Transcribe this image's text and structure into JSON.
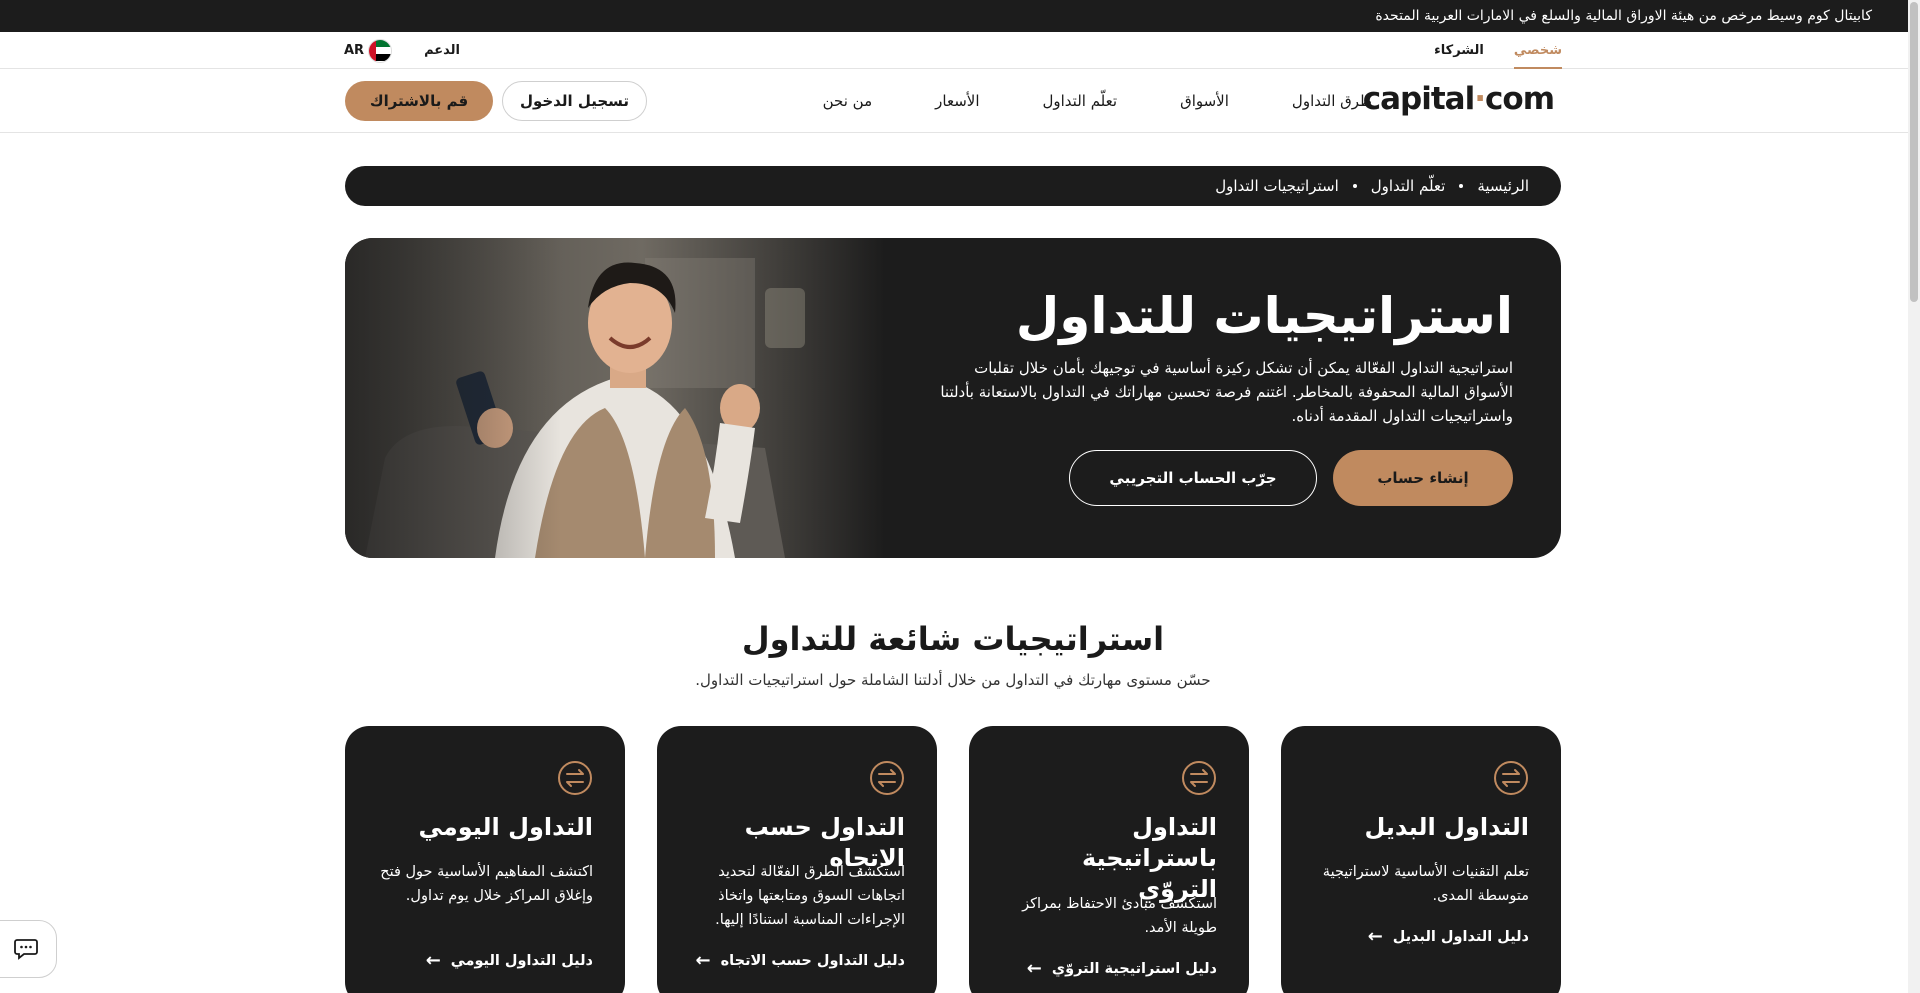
{
  "banner": {
    "text": "كابيتال كوم وسيط مرخص من هيئة الاوراق المالية والسلع في الامارات العربية المتحدة"
  },
  "account_tabs": [
    {
      "label": "شخصي",
      "active": true
    },
    {
      "label": "الشركاء",
      "active": false
    }
  ],
  "utility": {
    "support_label": "الدعم",
    "lang_label": "AR"
  },
  "logo": {
    "main": "capital",
    "dot": "·",
    "tld": "com"
  },
  "nav": {
    "items": [
      {
        "label": "طرق التداول"
      },
      {
        "label": "الأسواق"
      },
      {
        "label": "تعلّم التداول"
      },
      {
        "label": "الأسعار"
      },
      {
        "label": "من نحن"
      }
    ],
    "login_label": "تسجيل الدخول",
    "signup_label": "قم بالاشتراك"
  },
  "breadcrumb": [
    "الرئيسية",
    "تعلّم التداول",
    "استراتيجيات التداول"
  ],
  "hero": {
    "title": "استراتيجيات للتداول",
    "description": "استراتيجية التداول الفعّالة يمكن أن تشكل ركيزة أساسية في توجيهك بأمان خلال تقلبات الأسواق المالية المحفوفة بالمخاطر. اغتنم فرصة تحسين مهاراتك في التداول بالاستعانة بأدلتنا واستراتيجيات التداول المقدمة أدناه.",
    "create_account_label": "إنشاء حساب",
    "demo_label": "جرّب الحساب التجريبي"
  },
  "section": {
    "title": "استراتيجيات شائعة للتداول",
    "subtitle": "حسّن مستوى مهارتك في التداول من خلال أدلتنا الشاملة حول استراتيجيات التداول."
  },
  "cards": [
    {
      "title": "التداول البديل",
      "desc": "تعلم التقنيات الأساسية لاستراتيجية متوسطة المدى.",
      "link": "دليل التداول البديل"
    },
    {
      "title": "التداول باستراتيجية التروّي",
      "desc": "استكشف مبادئ الاحتفاظ بمراكز طويلة الأمد.",
      "link": "دليل استراتيجية التروّي"
    },
    {
      "title": "التداول حسب الاتجاه",
      "desc": "استكشف الطرق الفعّالة لتحديد اتجاهات السوق ومتابعتها واتخاذ الإجراءات المناسبة استنادًا إليها.",
      "link": "دليل التداول حسب الاتجاه"
    },
    {
      "title": "التداول اليومي",
      "desc": "اكتشف المفاهيم الأساسية حول فتح وإغلاق المراكز خلال يوم تداول.",
      "link": "دليل التداول اليومي"
    }
  ],
  "colors": {
    "accent": "#c08a5f",
    "dark": "#1c1c1c"
  },
  "icons": {
    "card_icon": "swap-arrows-icon",
    "link_arrow": "arrow-left-icon",
    "chat": "chat-bubble-icon"
  }
}
